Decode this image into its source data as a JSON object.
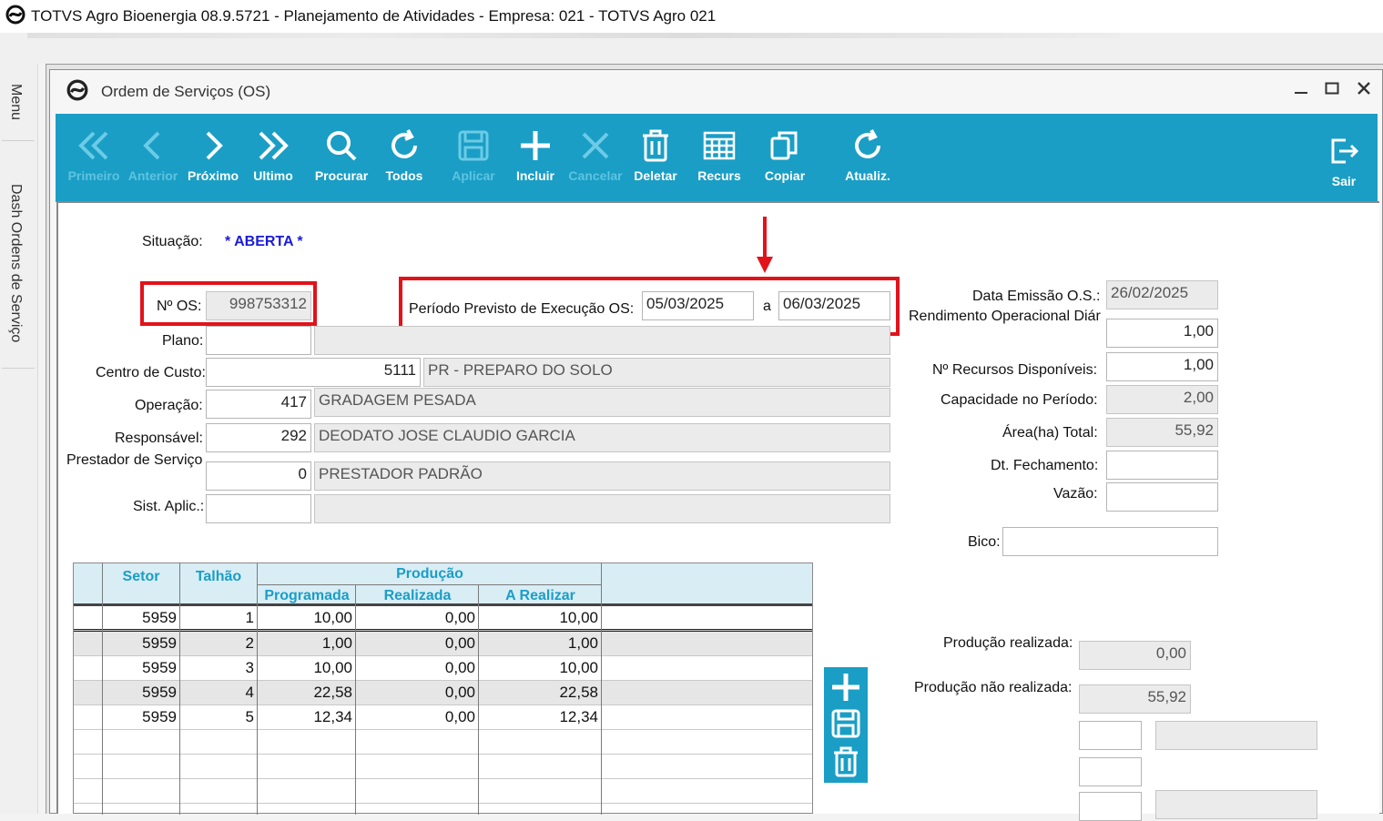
{
  "app": {
    "title": "TOTVS Agro Bioenergia 08.9.5721 - Planejamento de Atividades  - Empresa: 021 - TOTVS Agro 021"
  },
  "side_tabs": {
    "menu": "Menu",
    "dash": "Dash Ordens de Serviço"
  },
  "window": {
    "title": "Ordem de Serviços (OS)"
  },
  "toolbar": {
    "buttons": [
      {
        "label": "Primeiro",
        "icon": "double-chevron-left-icon",
        "enabled": false
      },
      {
        "label": "Anterior",
        "icon": "chevron-left-icon",
        "enabled": false
      },
      {
        "label": "Próximo",
        "icon": "chevron-right-icon",
        "enabled": true
      },
      {
        "label": "Ultimo",
        "icon": "double-chevron-right-icon",
        "enabled": true
      },
      {
        "label": "Procurar",
        "icon": "search-icon",
        "enabled": true
      },
      {
        "label": "Todos",
        "icon": "refresh-icon",
        "enabled": true
      },
      {
        "label": "Aplicar",
        "icon": "save-icon",
        "enabled": false
      },
      {
        "label": "Incluir",
        "icon": "plus-icon",
        "enabled": true
      },
      {
        "label": "Cancelar",
        "icon": "x-icon",
        "enabled": false
      },
      {
        "label": "Deletar",
        "icon": "trash-icon",
        "enabled": true
      },
      {
        "label": "Recurs",
        "icon": "grid-icon",
        "enabled": true
      },
      {
        "label": "Copiar",
        "icon": "copy-icon",
        "enabled": true
      },
      {
        "label": "Atualiz.",
        "icon": "refresh-icon",
        "enabled": true
      },
      {
        "label": "Sair",
        "icon": "exit-icon",
        "enabled": true
      }
    ],
    "accent": "#1a9ec5"
  },
  "form": {
    "situacao_label": "Situação:",
    "situacao_value": "* ABERTA *",
    "num_os_label": "Nº OS:",
    "num_os_value": "998753312",
    "periodo_label": "Período Previsto de Execução OS:",
    "periodo_inicio": "05/03/2025",
    "periodo_sep": "a",
    "periodo_fim": "06/03/2025",
    "plano_label": "Plano:",
    "plano_code": "",
    "plano_desc": "",
    "centro_custo_label": "Centro de Custo:",
    "centro_custo_code": "5111",
    "centro_custo_desc": "PR - PREPARO DO SOLO",
    "operacao_label": "Operação:",
    "operacao_code": "417",
    "operacao_desc": "GRADAGEM PESADA",
    "responsavel_label": "Responsável:",
    "responsavel_code": "292",
    "responsavel_desc": "DEODATO JOSE CLAUDIO GARCIA",
    "prestador_label": "Prestador de Serviço",
    "prestador_code": "0",
    "prestador_desc": "PRESTADOR PADRÃO",
    "sist_aplic_label": "Sist. Aplic.:",
    "sist_aplic_code": "",
    "sist_aplic_desc": "",
    "data_emissao_label": "Data Emissão O.S.:",
    "data_emissao_value": "26/02/2025",
    "rendimento_label": "Rendimento Operacional Diár",
    "rendimento_value": "1,00",
    "recursos_label": "Nº Recursos Disponíveis:",
    "recursos_value": "1,00",
    "capacidade_label": "Capacidade no Período:",
    "capacidade_value": "2,00",
    "area_label": "Área(ha) Total:",
    "area_value": "55,92",
    "dt_fechamento_label": "Dt. Fechamento:",
    "dt_fechamento_value": "",
    "vazao_label": "Vazão:",
    "vazao_value": "",
    "bico_label": "Bico:",
    "bico_value": "",
    "producao_realizada_label": "Produção realizada:",
    "producao_realizada_value": "0,00",
    "producao_nao_realizada_label": "Produção não realizada:",
    "producao_nao_realizada_value": "55,92"
  },
  "grid": {
    "headers": {
      "setor": "Setor",
      "talhao": "Talhão",
      "producao": "Produção",
      "programada": "Programada",
      "realizada": "Realizada",
      "a_realizar": "A Realizar"
    },
    "rows": [
      {
        "setor": "5959",
        "talhao": "1",
        "programada": "10,00",
        "realizada": "0,00",
        "a_realizar": "10,00"
      },
      {
        "setor": "5959",
        "talhao": "2",
        "programada": "1,00",
        "realizada": "0,00",
        "a_realizar": "1,00"
      },
      {
        "setor": "5959",
        "talhao": "3",
        "programada": "10,00",
        "realizada": "0,00",
        "a_realizar": "10,00"
      },
      {
        "setor": "5959",
        "talhao": "4",
        "programada": "22,58",
        "realizada": "0,00",
        "a_realizar": "22,58"
      },
      {
        "setor": "5959",
        "talhao": "5",
        "programada": "12,34",
        "realizada": "0,00",
        "a_realizar": "12,34"
      }
    ]
  },
  "annotation_color": "#e2121b"
}
